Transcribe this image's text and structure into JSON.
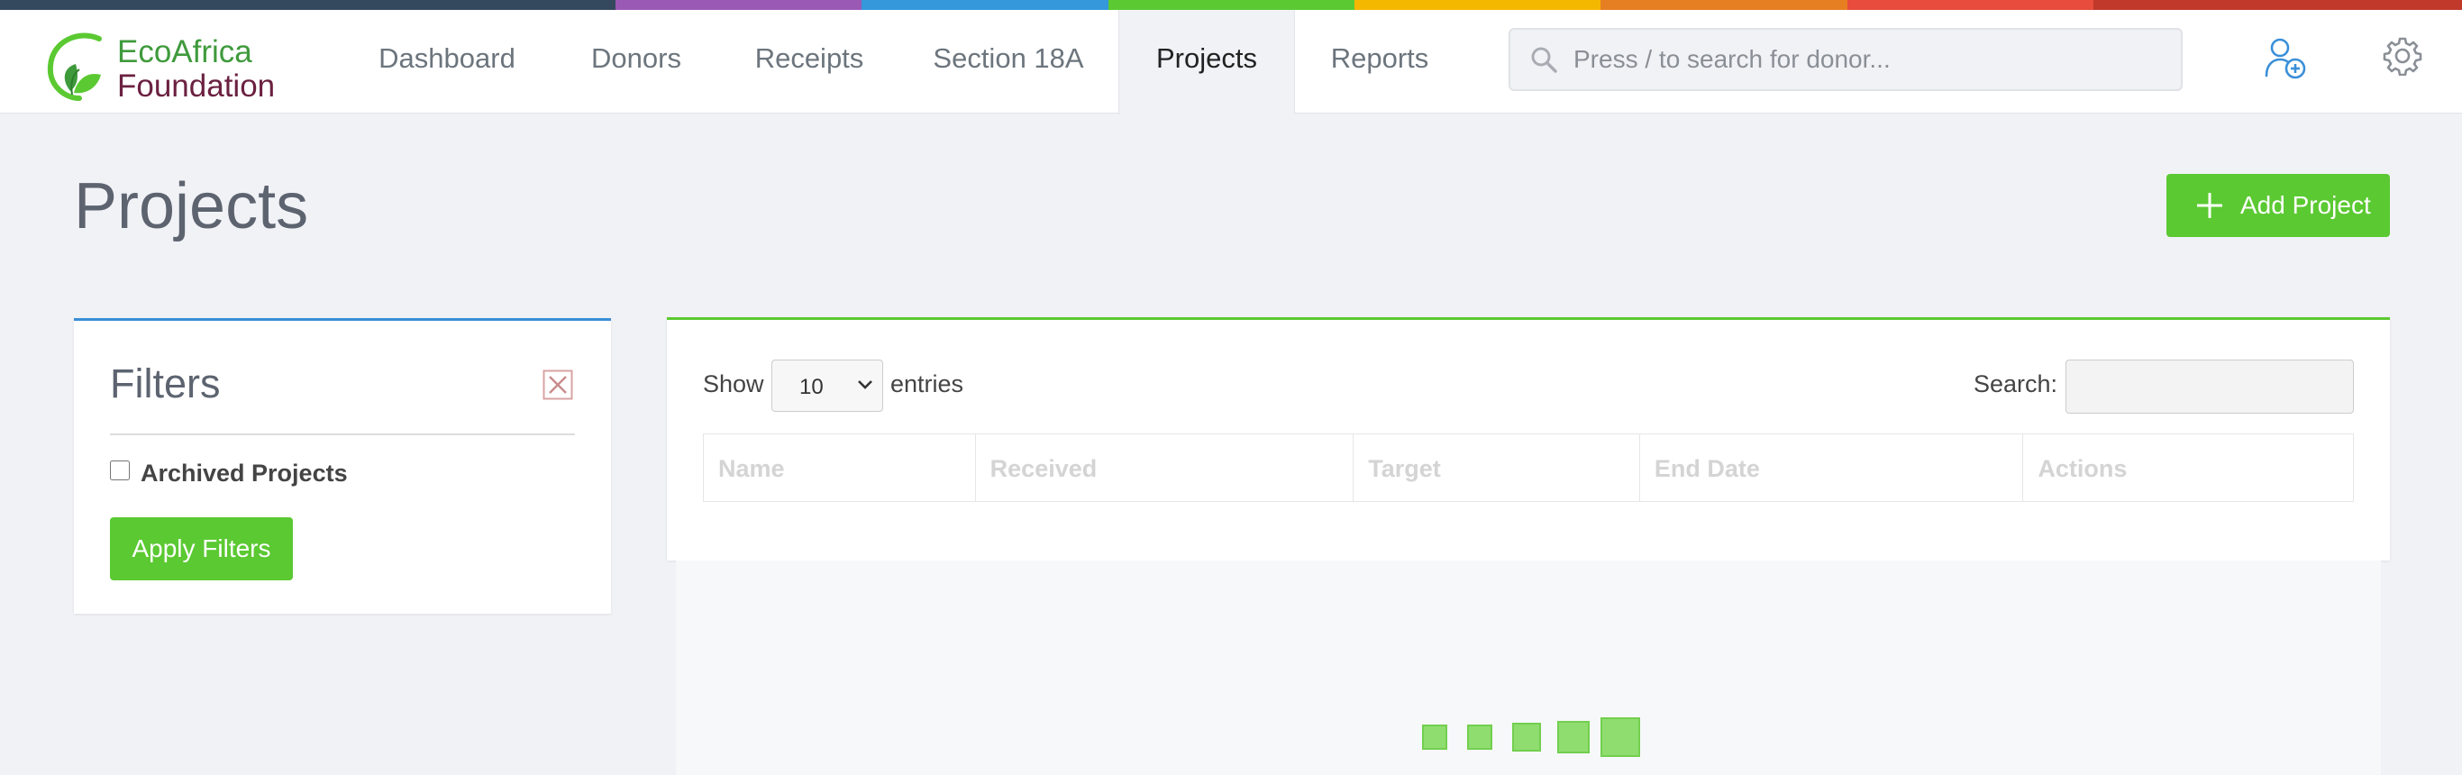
{
  "brand": {
    "line1": "EcoAfrica",
    "line2": "Foundation",
    "stripe_colors": [
      "#34495e",
      "#9b59b6",
      "#3498db",
      "#5bc932",
      "#f5b800",
      "#e67e22",
      "#e74c3c",
      "#c0392b"
    ]
  },
  "nav": {
    "items": [
      {
        "label": "Dashboard"
      },
      {
        "label": "Donors"
      },
      {
        "label": "Receipts"
      },
      {
        "label": "Section 18A"
      },
      {
        "label": "Projects"
      },
      {
        "label": "Reports"
      }
    ],
    "active": "Projects"
  },
  "search": {
    "placeholder": "Press / to search for donor..."
  },
  "icons": {
    "add_user": "user-plus-icon",
    "settings": "gear-icon",
    "search": "search-icon",
    "close_filters": "close-icon",
    "add": "plus-icon"
  },
  "page": {
    "title": "Projects",
    "add_button": "Add Project"
  },
  "filters": {
    "title": "Filters",
    "archived_label": "Archived Projects",
    "archived_checked": false,
    "apply_button": "Apply Filters"
  },
  "table": {
    "show_label": "Show",
    "entries_value": "10",
    "entries_label": "entries",
    "search_label": "Search:",
    "columns": [
      "Name",
      "Received",
      "Target",
      "End Date",
      "Actions"
    ]
  },
  "colors": {
    "accent_green": "#5bc932",
    "accent_blue": "#3a8fd8",
    "icon_blue": "#3a8fd8"
  }
}
